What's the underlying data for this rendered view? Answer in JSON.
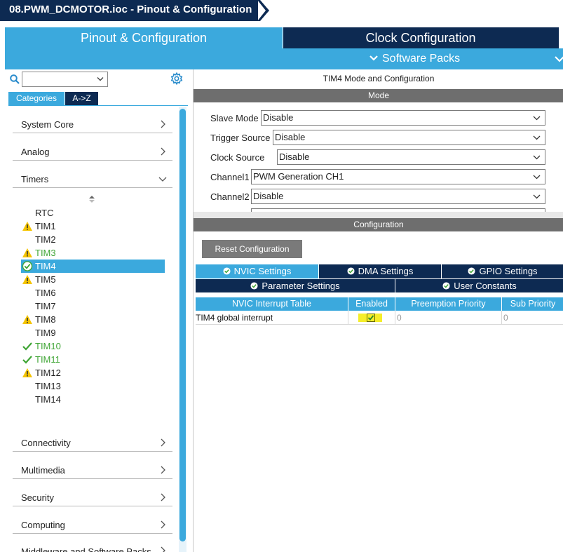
{
  "window": {
    "breadcrumb": "08.PWM_DCMOTOR.ioc - Pinout & Configuration"
  },
  "tabs": {
    "pinout": "Pinout & Configuration",
    "clock": "Clock Configuration",
    "software_packs": "Software Packs"
  },
  "left": {
    "search": {
      "value": ""
    },
    "view_tabs": {
      "categories": "Categories",
      "az": "A->Z"
    },
    "categories": [
      "System Core",
      "Analog",
      "Timers",
      "Connectivity",
      "Multimedia",
      "Security",
      "Computing",
      "Middleware and Software Packs"
    ],
    "timers": [
      {
        "label": "RTC",
        "status": "none"
      },
      {
        "label": "TIM1",
        "status": "warning"
      },
      {
        "label": "TIM2",
        "status": "none"
      },
      {
        "label": "TIM3",
        "status": "warning-green"
      },
      {
        "label": "TIM4",
        "status": "selected"
      },
      {
        "label": "TIM5",
        "status": "warning"
      },
      {
        "label": "TIM6",
        "status": "none"
      },
      {
        "label": "TIM7",
        "status": "none"
      },
      {
        "label": "TIM8",
        "status": "warning"
      },
      {
        "label": "TIM9",
        "status": "none"
      },
      {
        "label": "TIM10",
        "status": "check-green"
      },
      {
        "label": "TIM11",
        "status": "check-green"
      },
      {
        "label": "TIM12",
        "status": "warning"
      },
      {
        "label": "TIM13",
        "status": "none"
      },
      {
        "label": "TIM14",
        "status": "none"
      }
    ]
  },
  "right": {
    "title": "TIM4 Mode and Configuration",
    "mode_header": "Mode",
    "mode_fields": [
      {
        "label": "Slave Mode",
        "value": "Disable"
      },
      {
        "label": "Trigger Source",
        "value": "Disable"
      },
      {
        "label": "Clock Source",
        "value": "Disable"
      },
      {
        "label": "Channel1",
        "value": "PWM Generation CH1"
      },
      {
        "label": "Channel2",
        "value": "Disable"
      }
    ],
    "config_header": "Configuration",
    "reset_button": "Reset Configuration",
    "settings_tabs_row1": [
      "NVIC Settings",
      "DMA Settings",
      "GPIO Settings"
    ],
    "settings_tabs_row2": [
      "Parameter Settings",
      "User Constants"
    ],
    "nvic_table": {
      "headers": [
        "NVIC Interrupt Table",
        "Enabled",
        "Preemption Priority",
        "Sub Priority"
      ],
      "rows": [
        {
          "name": "TIM4 global interrupt",
          "enabled": true,
          "preemption": "0",
          "sub": "0"
        }
      ]
    }
  },
  "colors": {
    "navy": "#0d2a52",
    "accent": "#3ba9dd",
    "header_gray": "#6e6e6e",
    "warning": "#f5c400",
    "ok_green": "#3fa535"
  }
}
